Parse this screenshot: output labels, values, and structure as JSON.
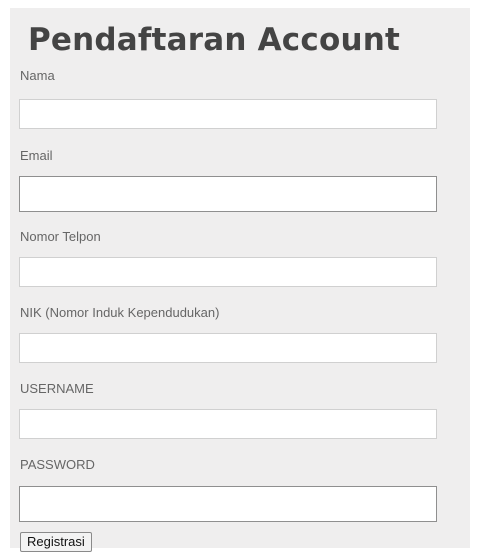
{
  "form": {
    "title": "Pendaftaran Account",
    "fields": [
      {
        "label": "Nama",
        "value": "",
        "placeholder": ""
      },
      {
        "label": "Email",
        "value": "",
        "placeholder": ""
      },
      {
        "label": "Nomor Telpon",
        "value": "",
        "placeholder": ""
      },
      {
        "label": "NIK (Nomor Induk Kependudukan)",
        "value": "",
        "placeholder": ""
      },
      {
        "label": "USERNAME",
        "value": "",
        "placeholder": ""
      },
      {
        "label": "PASSWORD",
        "value": "",
        "placeholder": ""
      }
    ],
    "submit_label": "Registrasi"
  }
}
